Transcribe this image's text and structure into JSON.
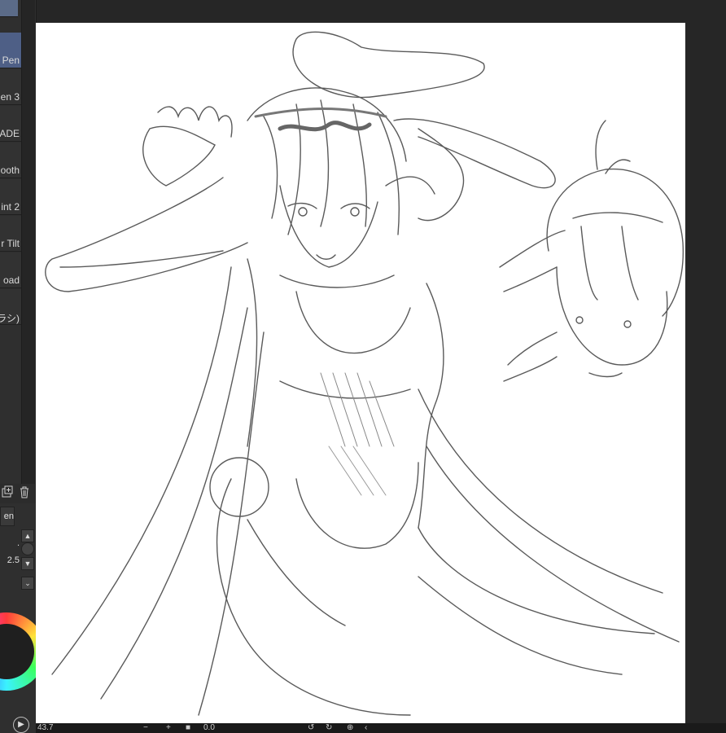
{
  "tools": {
    "items": [
      {
        "label": "Pen",
        "selected": true
      },
      {
        "label": "en 3",
        "selected": false
      },
      {
        "label": "ADE",
        "selected": false
      },
      {
        "label": "ooth",
        "selected": false
      },
      {
        "label": "int 2",
        "selected": false
      },
      {
        "label": "r Tilt",
        "selected": false
      },
      {
        "label": "oad",
        "selected": false
      },
      {
        "label": "ラシ)",
        "selected": false
      }
    ]
  },
  "properties": {
    "tab_label": "en",
    "value_row_1": ".",
    "value_row_2": "2.5"
  },
  "status": {
    "zoom": "43.7",
    "angle": "0.0",
    "zoom_out": "−",
    "zoom_in": "+"
  },
  "colors": {
    "panel": "#2f2f2f",
    "selected": "#4e5f86",
    "canvas": "#ffffff",
    "stroke": "#555555"
  }
}
